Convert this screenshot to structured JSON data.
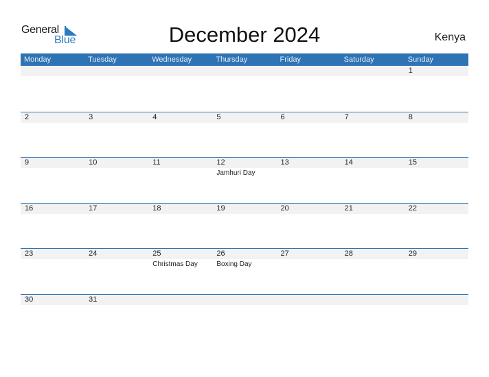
{
  "logo": {
    "general": "General",
    "blue": "Blue",
    "icon": "triangle-flag-icon"
  },
  "title": "December 2024",
  "country": "Kenya",
  "colors": {
    "header": "#2e73b4",
    "band": "#f2f2f2",
    "brand_blue": "#2a7ac0"
  },
  "weekdays": [
    "Monday",
    "Tuesday",
    "Wednesday",
    "Thursday",
    "Friday",
    "Saturday",
    "Sunday"
  ],
  "weeks": [
    [
      {
        "day": ""
      },
      {
        "day": ""
      },
      {
        "day": ""
      },
      {
        "day": ""
      },
      {
        "day": ""
      },
      {
        "day": ""
      },
      {
        "day": "1"
      }
    ],
    [
      {
        "day": "2"
      },
      {
        "day": "3"
      },
      {
        "day": "4"
      },
      {
        "day": "5"
      },
      {
        "day": "6"
      },
      {
        "day": "7"
      },
      {
        "day": "8"
      }
    ],
    [
      {
        "day": "9"
      },
      {
        "day": "10"
      },
      {
        "day": "11"
      },
      {
        "day": "12",
        "holiday": "Jamhuri Day"
      },
      {
        "day": "13"
      },
      {
        "day": "14"
      },
      {
        "day": "15"
      }
    ],
    [
      {
        "day": "16"
      },
      {
        "day": "17"
      },
      {
        "day": "18"
      },
      {
        "day": "19"
      },
      {
        "day": "20"
      },
      {
        "day": "21"
      },
      {
        "day": "22"
      }
    ],
    [
      {
        "day": "23"
      },
      {
        "day": "24"
      },
      {
        "day": "25",
        "holiday": "Christmas Day"
      },
      {
        "day": "26",
        "holiday": "Boxing Day"
      },
      {
        "day": "27"
      },
      {
        "day": "28"
      },
      {
        "day": "29"
      }
    ],
    [
      {
        "day": "30"
      },
      {
        "day": "31"
      },
      {
        "day": ""
      },
      {
        "day": ""
      },
      {
        "day": ""
      },
      {
        "day": ""
      },
      {
        "day": ""
      }
    ]
  ]
}
